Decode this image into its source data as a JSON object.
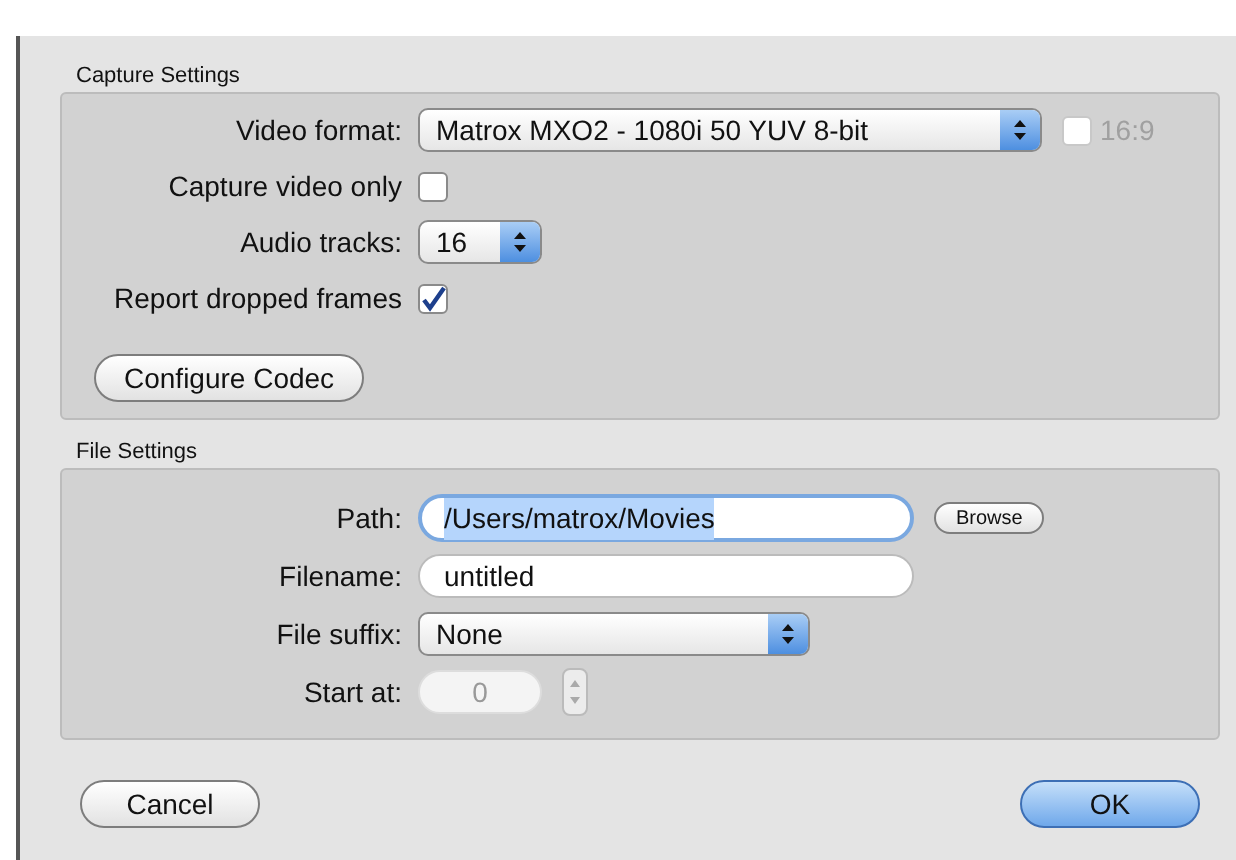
{
  "capture_settings": {
    "title": "Capture Settings",
    "video_format": {
      "label": "Video format:",
      "value": "Matrox MXO2 - 1080i 50 YUV 8-bit"
    },
    "aspect_ratio": {
      "label": "16:9",
      "checked": false,
      "disabled": true
    },
    "capture_video_only": {
      "label": "Capture video only",
      "checked": false
    },
    "audio_tracks": {
      "label": "Audio tracks:",
      "value": "16"
    },
    "report_dropped_frames": {
      "label": "Report dropped frames",
      "checked": true
    },
    "configure_button": "Configure Codec"
  },
  "file_settings": {
    "title": "File Settings",
    "path": {
      "label": "Path:",
      "value": "/Users/matrox/Movies",
      "focused": true
    },
    "browse_button": "Browse",
    "filename": {
      "label": "Filename:",
      "value": "untitled"
    },
    "file_suffix": {
      "label": "File suffix:",
      "value": "None"
    },
    "start_at": {
      "label": "Start at:",
      "value": "0",
      "disabled": true
    }
  },
  "buttons": [
    {
      "label": "Cancel",
      "default": false
    },
    {
      "label": "OK",
      "default": true
    }
  ]
}
